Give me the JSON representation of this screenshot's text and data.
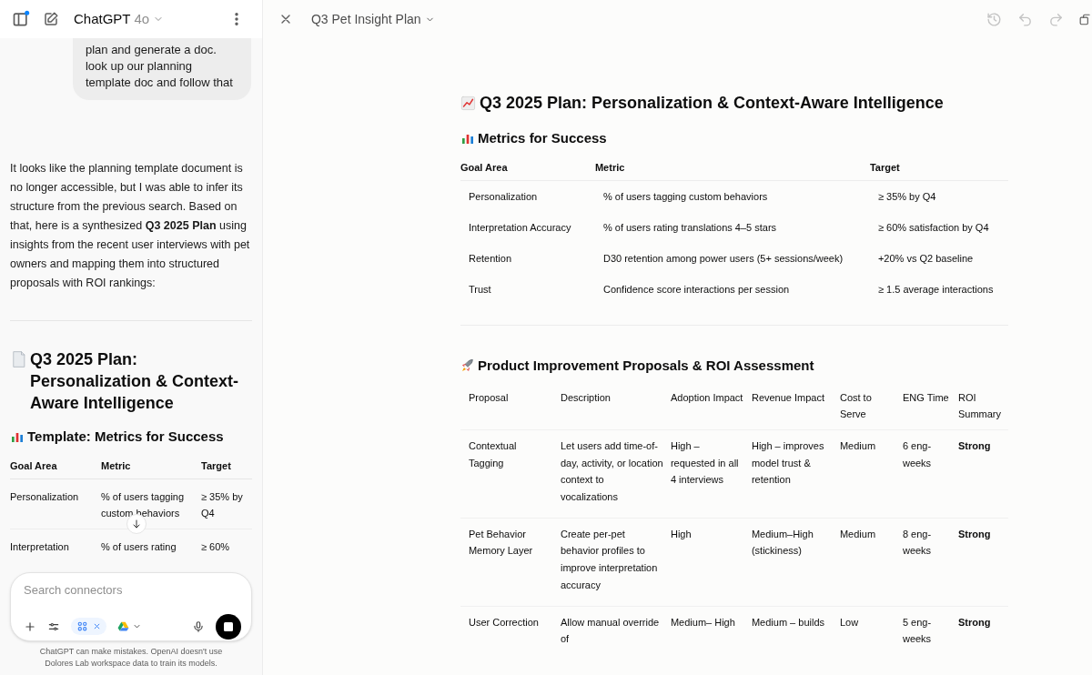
{
  "chat_header": {
    "title": "ChatGPT",
    "model": "4o"
  },
  "user_message": "plan and generate a doc. look up our planning template doc and follow that",
  "assistant_intro": "It looks like the planning template document is no longer accessible, but I was able to infer its structure from the previous search. Based on that, here is a synthesized **Q3 2025 Plan** using insights from the recent user interviews with pet owners and mapping them into structured proposals with ROI rankings:",
  "chat_doc": {
    "heading": "Q3 2025 Plan: Personalization & Context-Aware Intelligence",
    "subheading": "Template: Metrics for Success",
    "columns": [
      "Goal Area",
      "Metric",
      "Target"
    ],
    "rows": [
      [
        "Personalization",
        "% of users tagging custom behaviors",
        "≥ 35% by Q4"
      ],
      [
        "Interpretation",
        "% of users rating",
        "≥ 60%"
      ]
    ]
  },
  "composer": {
    "placeholder": "Search connectors",
    "disclaimer": "ChatGPT can make mistakes. OpenAI doesn't use Dolores Lab workspace data to train its models."
  },
  "canvas": {
    "title": "Q3 Pet Insight Plan",
    "doc_title": "Q3 2025 Plan: Personalization & Context-Aware Intelligence",
    "metrics": {
      "heading": "Metrics for Success",
      "columns": [
        "Goal Area",
        "Metric",
        "Target"
      ],
      "rows": [
        [
          "Personalization",
          "% of users tagging custom behaviors",
          "≥ 35% by Q4"
        ],
        [
          "Interpretation Accuracy",
          "% of users rating translations 4–5 stars",
          "≥ 60% satisfaction by Q4"
        ],
        [
          "Retention",
          "D30 retention among power users (5+ sessions/week)",
          "+20% vs Q2 baseline"
        ],
        [
          "Trust",
          "Confidence score interactions per session",
          "≥ 1.5 average interactions"
        ]
      ]
    },
    "proposals": {
      "heading": "Product Improvement Proposals & ROI Assessment",
      "columns": [
        "Proposal",
        "Description",
        "Adoption Impact",
        "Revenue Impact",
        "Cost to Serve",
        "ENG Time",
        "ROI Summary"
      ],
      "rows": [
        [
          "Contextual Tagging",
          "Let users add time-of-day, activity, or location context to vocalizations",
          "High – requested in all 4 interviews",
          "High – improves model trust & retention",
          "Medium",
          "6 eng-weeks",
          "Strong"
        ],
        [
          "Pet Behavior Memory Layer",
          "Create per-pet behavior profiles to improve interpretation accuracy",
          "High",
          "Medium–High (stickiness)",
          "Medium",
          "8 eng-weeks",
          "Strong"
        ],
        [
          "User Correction",
          "Allow manual override of",
          "Medium– High",
          "Medium – builds",
          "Low",
          "5 eng-weeks",
          "Strong"
        ]
      ]
    }
  }
}
